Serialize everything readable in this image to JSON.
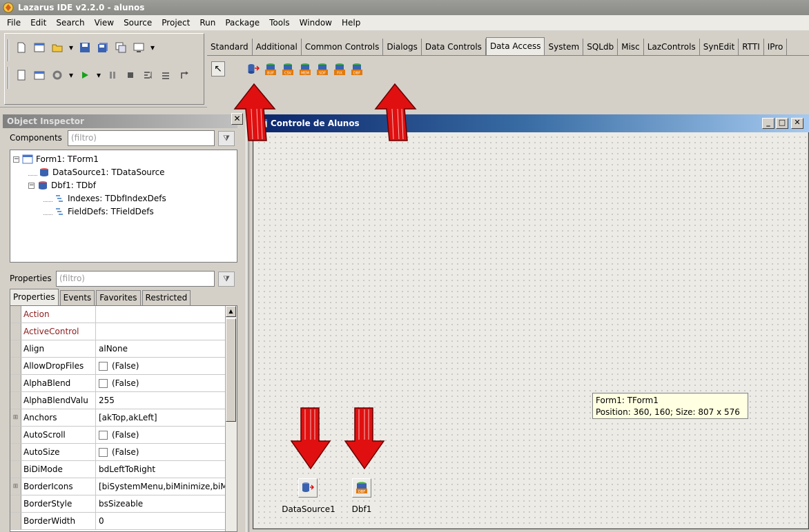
{
  "window": {
    "title": "Lazarus IDE v2.2.0 - alunos"
  },
  "menu": [
    "File",
    "Edit",
    "Search",
    "View",
    "Source",
    "Project",
    "Run",
    "Package",
    "Tools",
    "Window",
    "Help"
  ],
  "palette_tabs": [
    "Standard",
    "Additional",
    "Common Controls",
    "Dialogs",
    "Data Controls",
    "Data Access",
    "System",
    "SQLdb",
    "Misc",
    "LazControls",
    "SynEdit",
    "RTTI",
    "IPro"
  ],
  "active_palette_tab": "Data Access",
  "palette_icons": [
    {
      "name": "tdatasource-icon",
      "badge": ""
    },
    {
      "name": "tbufdataset-icon",
      "badge": "BUF"
    },
    {
      "name": "tcsvdataset-icon",
      "badge": "CSV"
    },
    {
      "name": "tmemdataset-icon",
      "badge": "MEM"
    },
    {
      "name": "tsdfdataset-icon",
      "badge": "SDF"
    },
    {
      "name": "tfixedformatdataset-icon",
      "badge": "FIX"
    },
    {
      "name": "tdbf-icon",
      "badge": "DBF"
    }
  ],
  "object_inspector": {
    "title": "Object Inspector",
    "components_label": "Components",
    "components_filter_placeholder": "(filtro)",
    "properties_label": "Properties",
    "properties_filter_placeholder": "(filtro)",
    "tree": [
      {
        "text": "Form1: TForm1",
        "level": 0,
        "toggle": "⊟"
      },
      {
        "text": "DataSource1: TDataSource",
        "level": 1,
        "toggle": ""
      },
      {
        "text": "Dbf1: TDbf",
        "level": 1,
        "toggle": "⊟"
      },
      {
        "text": "Indexes: TDbfIndexDefs",
        "level": 2,
        "toggle": ""
      },
      {
        "text": "FieldDefs: TFieldDefs",
        "level": 2,
        "toggle": ""
      }
    ],
    "prop_tabs": [
      "Properties",
      "Events",
      "Favorites",
      "Restricted"
    ],
    "properties": [
      {
        "name": "Action",
        "value": "",
        "red": true,
        "check": false,
        "expand": false
      },
      {
        "name": "ActiveControl",
        "value": "",
        "red": true,
        "check": false,
        "expand": false
      },
      {
        "name": "Align",
        "value": "alNone",
        "red": false,
        "check": false,
        "expand": false
      },
      {
        "name": "AllowDropFiles",
        "value": "(False)",
        "red": false,
        "check": true,
        "expand": false
      },
      {
        "name": "AlphaBlend",
        "value": "(False)",
        "red": false,
        "check": true,
        "expand": false
      },
      {
        "name": "AlphaBlendValu",
        "value": "255",
        "red": false,
        "check": false,
        "expand": false
      },
      {
        "name": "Anchors",
        "value": "[akTop,akLeft]",
        "red": false,
        "check": false,
        "expand": true
      },
      {
        "name": "AutoScroll",
        "value": "(False)",
        "red": false,
        "check": true,
        "expand": false
      },
      {
        "name": "AutoSize",
        "value": "(False)",
        "red": false,
        "check": true,
        "expand": false
      },
      {
        "name": "BiDiMode",
        "value": "bdLeftToRight",
        "red": false,
        "check": false,
        "expand": false
      },
      {
        "name": "BorderIcons",
        "value": "[biSystemMenu,biMinimize,biMax",
        "red": false,
        "check": false,
        "expand": true
      },
      {
        "name": "BorderStyle",
        "value": "bsSizeable",
        "red": false,
        "check": false,
        "expand": false
      },
      {
        "name": "BorderWidth",
        "value": "0",
        "red": false,
        "check": false,
        "expand": false
      }
    ]
  },
  "form": {
    "title": "Controle de Alunos",
    "hint_line1": "Form1: TForm1",
    "hint_line2": "Position: 360, 160; Size: 807 x 576",
    "components": [
      {
        "label": "DataSource1",
        "icon": "tdatasource-icon",
        "badge": ""
      },
      {
        "label": "Dbf1",
        "icon": "tdbf-icon",
        "badge": "DBF"
      }
    ]
  },
  "colors": {
    "form_title_start": "#0a246a",
    "form_title_end": "#a6caf0",
    "arrow": "#e01010",
    "property_red": "#8b1a1a",
    "badge_orange": "#e07a10",
    "db_blue": "#3a62b0"
  }
}
